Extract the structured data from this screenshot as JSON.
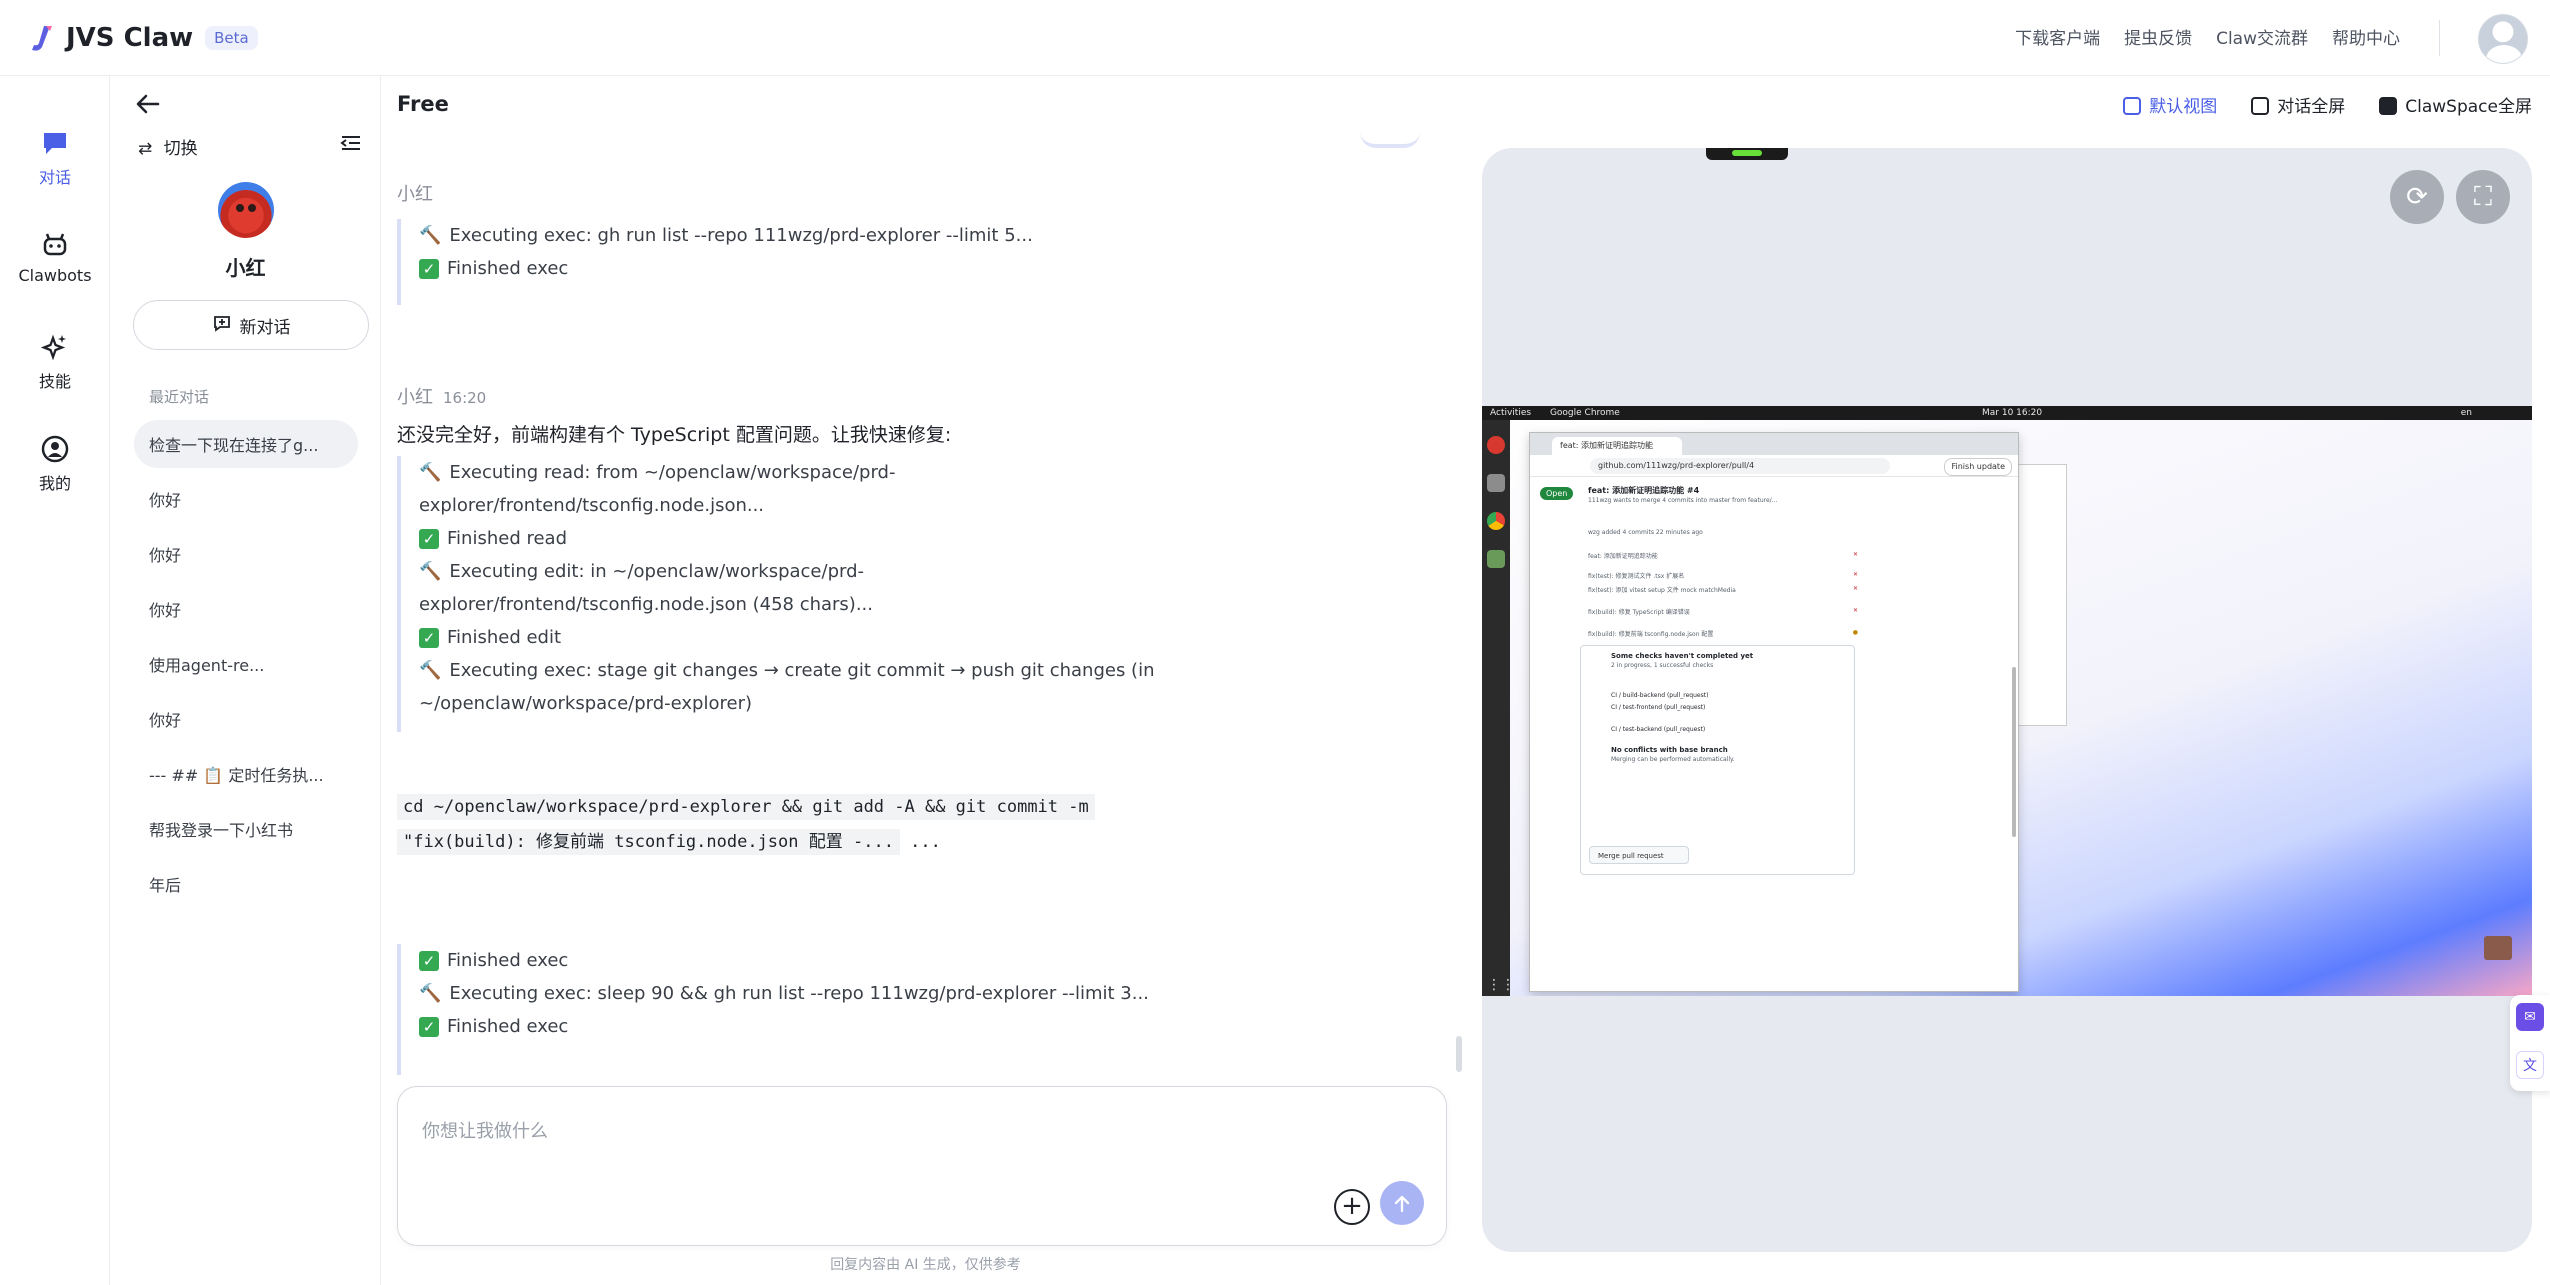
{
  "brand": {
    "name": "JVS Claw",
    "badge": "Beta",
    "accent": "#4a5ee6"
  },
  "top_links": [
    "下载客户端",
    "提虫反馈",
    "Claw交流群",
    "帮助中心"
  ],
  "left_nav": [
    {
      "label": "对话",
      "icon": "chat-icon",
      "active": true
    },
    {
      "label": "Clawbots",
      "icon": "bot-icon",
      "active": false
    },
    {
      "label": "技能",
      "icon": "sparkle-icon",
      "active": false
    },
    {
      "label": "我的",
      "icon": "user-icon",
      "active": false
    }
  ],
  "sidebar": {
    "switch_label": "切换",
    "bot_name": "小红",
    "new_chat_label": "新对话",
    "recent_label": "最近对话",
    "conversations": [
      "检查一下现在连接了g...",
      "你好",
      "你好",
      "你好",
      "使用agent-re...",
      "你好",
      "--- ## 📋 定时任务执...",
      "帮我登录一下小红书",
      "年后"
    ]
  },
  "chat": {
    "title": "Free",
    "messages": [
      {
        "sender": "小红",
        "time": "",
        "blocks": [
          {
            "icon": "hammer",
            "text": "Executing exec: gh run list --repo 111wzg/prd-explorer --limit 5..."
          },
          {
            "icon": "check",
            "text": "Finished exec"
          }
        ]
      },
      {
        "sender": "小红",
        "time": "16:20",
        "intro": "还没完全好，前端构建有个 TypeScript 配置问题。让我快速修复:",
        "blocks": [
          {
            "icon": "hammer",
            "text": "Executing read: from ~/openclaw/workspace/prd-"
          },
          {
            "icon": "",
            "text": "explorer/frontend/tsconfig.node.json..."
          },
          {
            "icon": "check",
            "text": "Finished read"
          },
          {
            "icon": "hammer",
            "text": "Executing edit: in ~/openclaw/workspace/prd-"
          },
          {
            "icon": "",
            "text": "explorer/frontend/tsconfig.node.json (458 chars)..."
          },
          {
            "icon": "check",
            "text": "Finished edit"
          },
          {
            "icon": "hammer",
            "text": "Executing exec: stage git changes → create git commit → push git changes (in"
          },
          {
            "icon": "",
            "text": "~/openclaw/workspace/prd-explorer)"
          }
        ],
        "code": [
          "cd ~/openclaw/workspace/prd-explorer && git add -A && git commit -m",
          "\"fix(build): 修复前端 tsconfig.node.json 配置 -..."
        ],
        "code_suffix": " ...",
        "blocks2": [
          {
            "icon": "check",
            "text": "Finished exec"
          },
          {
            "icon": "hammer",
            "text": "Executing exec: sleep 90 && gh run list --repo 111wzg/prd-explorer --limit 3..."
          },
          {
            "icon": "check",
            "text": "Finished exec"
          }
        ]
      }
    ],
    "input_placeholder": "你想让我做什么",
    "disclaimer": "回复内容由 AI 生成，仅供参考"
  },
  "view_modes": [
    {
      "label": "默认视图",
      "active": true
    },
    {
      "label": "对话全屏",
      "active": false
    },
    {
      "label": "ClawSpace全屏",
      "active": false
    }
  ],
  "desktop": {
    "topbar_left": "Activities",
    "topbar_app": "Google Chrome",
    "topbar_clock": "Mar 10 16:20",
    "topbar_right": "en",
    "tab_title": "feat: 添加新证明追踪功能",
    "url": "github.com/111wzg/prd-explorer/pull/4",
    "update_btn": "Finish update",
    "pr_state": "Open",
    "pr_title": "feat: 添加新证明追踪功能 #4",
    "pr_sub": "111wzg wants to merge 4 commits into master from feature/...",
    "commits_header": "wzg added 4 commits 22 minutes ago",
    "commits": [
      "feat: 添加新证明追踪功能",
      "fix(test): 修复测试文件 .tsx 扩展名",
      "fix(test): 添加 vitest setup 文件 mock matchMedia",
      "fix(build): 修复 TypeScript 编译错误",
      "fix(build): 修复前端 tsconfig.node.json 配置"
    ],
    "checks_title": "Some checks haven't completed yet",
    "checks_sub": "2 in progress, 1 successful checks",
    "checks": [
      "CI / build-backend (pull_request)",
      "CI / test-frontend (pull_request)",
      "CI / test-backend (pull_request)"
    ],
    "no_conflicts": "No conflicts with base branch",
    "no_conflicts_sub": "Merging can be performed automatically.",
    "merge_btn": "Merge pull request"
  }
}
